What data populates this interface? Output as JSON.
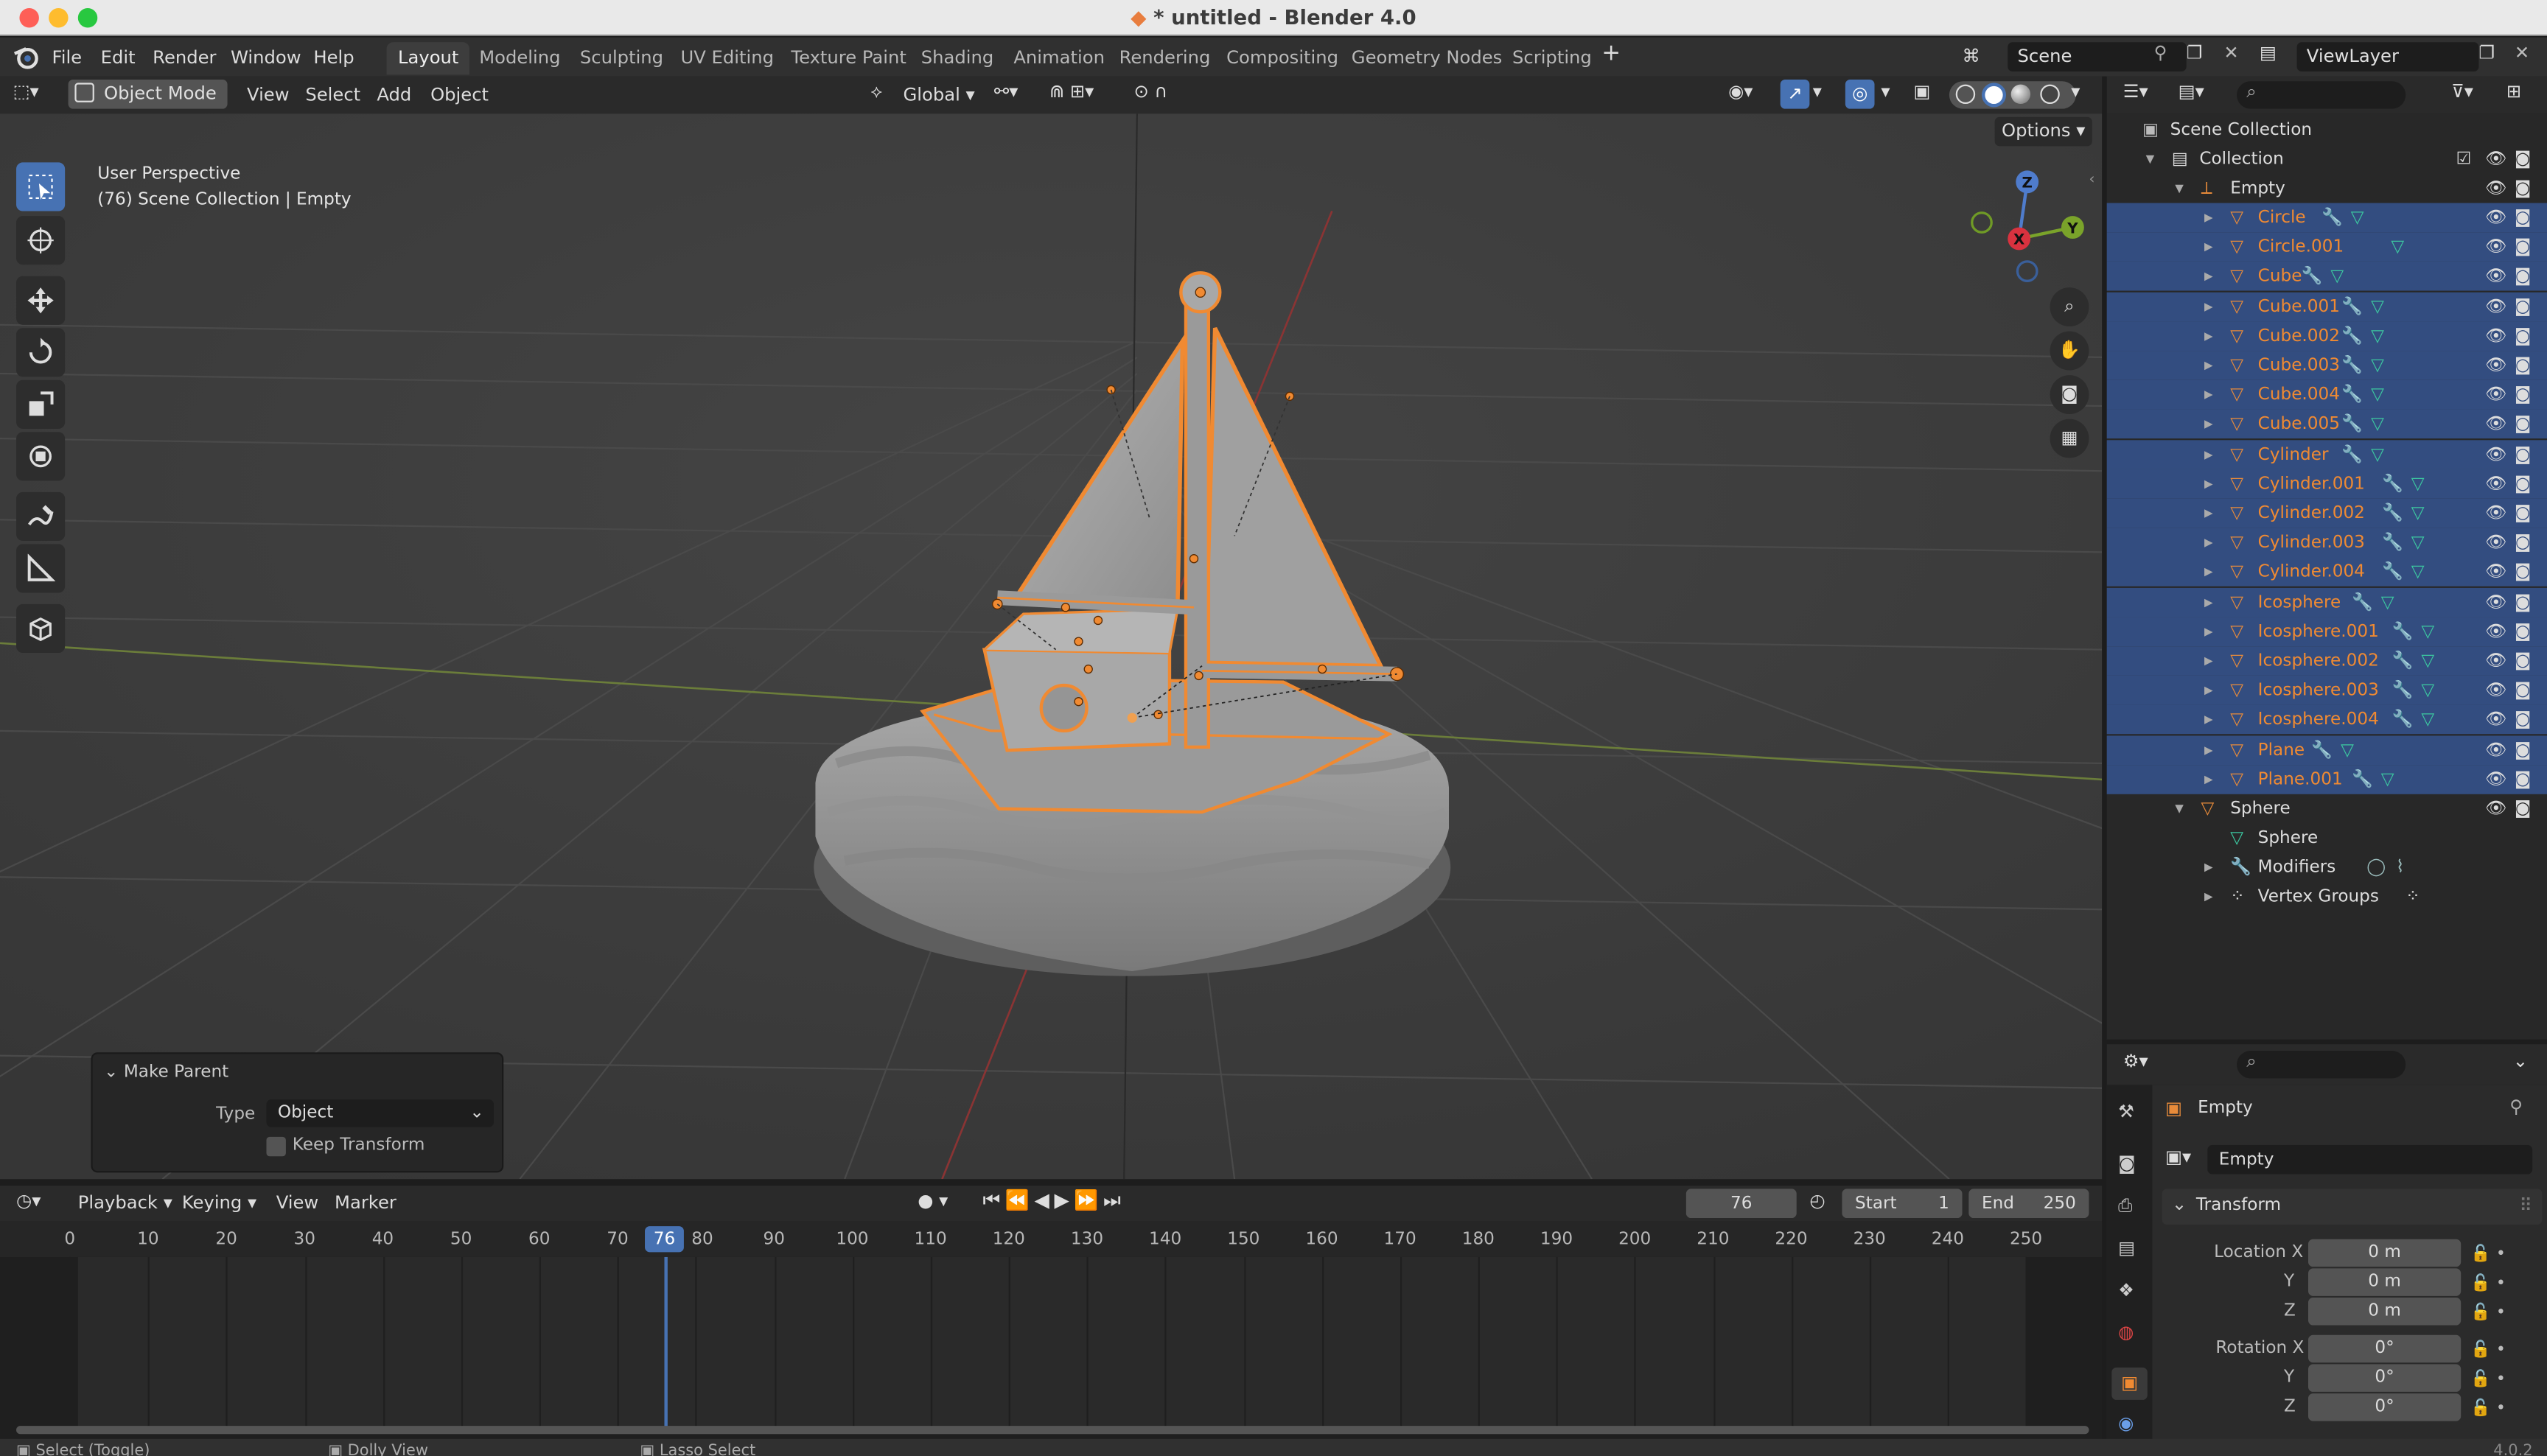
{
  "window": {
    "title": "untitled - Blender 4.0",
    "modified_mark": "* "
  },
  "menu": {
    "items": [
      "File",
      "Edit",
      "Render",
      "Window",
      "Help"
    ]
  },
  "workspaces": {
    "tabs": [
      "Layout",
      "Modeling",
      "Sculpting",
      "UV Editing",
      "Texture Paint",
      "Shading",
      "Animation",
      "Rendering",
      "Compositing",
      "Geometry Nodes",
      "Scripting"
    ],
    "active": "Layout"
  },
  "scene": {
    "name": "Scene",
    "view_layer": "ViewLayer"
  },
  "viewport_header": {
    "mode": "Object Mode",
    "menus": [
      "View",
      "Select",
      "Add",
      "Object"
    ],
    "transform_orientation": "Global",
    "options_label": "Options"
  },
  "viewport": {
    "perspective": "User Perspective",
    "context": "(76) Scene Collection | Empty"
  },
  "make_parent": {
    "title": "Make Parent",
    "type_label": "Type",
    "type_value": "Object",
    "keep_transform_label": "Keep Transform",
    "keep_transform": false
  },
  "gizmo": {
    "x": "X",
    "y": "Y",
    "z": "Z"
  },
  "outliner": {
    "scene_collection": "Scene Collection",
    "collection": "Collection",
    "parent": "Empty",
    "children": [
      "Circle",
      "Circle.001",
      "Cube",
      "Cube.001",
      "Cube.002",
      "Cube.003",
      "Cube.004",
      "Cube.005",
      "Cylinder",
      "Cylinder.001",
      "Cylinder.002",
      "Cylinder.003",
      "Cylinder.004",
      "Icosphere",
      "Icosphere.001",
      "Icosphere.002",
      "Icosphere.003",
      "Icosphere.004",
      "Plane",
      "Plane.001"
    ],
    "sphere": "Sphere",
    "sphere_children": [
      "Sphere",
      "Modifiers",
      "Vertex Groups"
    ]
  },
  "properties": {
    "object_name": "Empty",
    "datablock": "Empty",
    "panel": "Transform",
    "location_label": "Location X",
    "rotation_label": "Rotation X",
    "y_label": "Y",
    "z_label": "Z",
    "location": [
      "0 m",
      "0 m",
      "0 m"
    ],
    "rotation": [
      "0°",
      "0°",
      "0°"
    ]
  },
  "timeline": {
    "menus": [
      "Playback",
      "Keying",
      "View",
      "Marker"
    ],
    "current_frame": "76",
    "start_label": "Start",
    "start": "1",
    "end_label": "End",
    "end": "250",
    "ticks": [
      "0",
      "10",
      "20",
      "30",
      "40",
      "50",
      "60",
      "70",
      "80",
      "90",
      "100",
      "110",
      "120",
      "130",
      "140",
      "150",
      "160",
      "170",
      "180",
      "190",
      "200",
      "210",
      "220",
      "230",
      "240",
      "250"
    ]
  },
  "statusbar": {
    "items": [
      "Select (Toggle)",
      "Dolly View",
      "Lasso Select"
    ],
    "version": "4.0.2"
  },
  "colors": {
    "selected_orange": "#f08a32",
    "active_blue": "#4772b3",
    "outliner_select": "#334d80"
  }
}
